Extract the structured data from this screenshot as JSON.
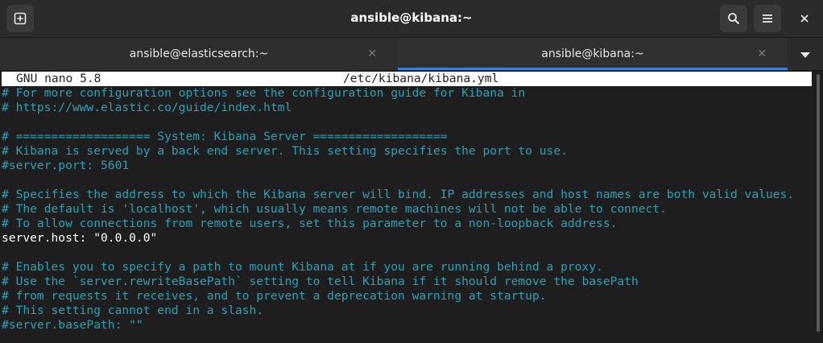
{
  "window": {
    "title": "ansible@kibana:~"
  },
  "icons": {
    "new_tab": "new-tab-icon",
    "search": "search-icon",
    "menu": "hamburger-menu-icon",
    "close": "close-icon",
    "tab_close": "tab-close-icon",
    "tab_dropdown": "chevron-down-icon"
  },
  "tabs": [
    {
      "label": "ansible@elasticsearch:~",
      "active": false
    },
    {
      "label": "ansible@kibana:~",
      "active": true
    }
  ],
  "nano": {
    "version": "GNU nano 5.8",
    "filename": "/etc/kibana/kibana.yml"
  },
  "lines": [
    {
      "text": "# For more configuration options see the configuration guide for Kibana in",
      "type": "comment"
    },
    {
      "text": "# https://www.elastic.co/guide/index.html",
      "type": "comment"
    },
    {
      "text": "",
      "type": "blank"
    },
    {
      "text": "# =================== System: Kibana Server ===================",
      "type": "comment"
    },
    {
      "text": "# Kibana is served by a back end server. This setting specifies the port to use.",
      "type": "comment"
    },
    {
      "text": "#server.port: 5601",
      "type": "comment"
    },
    {
      "text": "",
      "type": "blank"
    },
    {
      "text": "# Specifies the address to which the Kibana server will bind. IP addresses and host names are both valid values.",
      "type": "comment"
    },
    {
      "text": "# The default is 'localhost', which usually means remote machines will not be able to connect.",
      "type": "comment"
    },
    {
      "text": "# To allow connections from remote users, set this parameter to a non-loopback address.",
      "type": "comment"
    },
    {
      "text": "server.host: \"0.0.0.0\"",
      "type": "plain"
    },
    {
      "text": "",
      "type": "blank"
    },
    {
      "text": "# Enables you to specify a path to mount Kibana at if you are running behind a proxy.",
      "type": "comment"
    },
    {
      "text": "# Use the `server.rewriteBasePath` setting to tell Kibana if it should remove the basePath",
      "type": "comment"
    },
    {
      "text": "# from requests it receives, and to prevent a deprecation warning at startup.",
      "type": "comment"
    },
    {
      "text": "# This setting cannot end in a slash.",
      "type": "comment"
    },
    {
      "text": "#server.basePath: \"\"",
      "type": "comment"
    }
  ],
  "colors": {
    "comment": "#2aa1b3",
    "text": "#ffffff",
    "accent": "#3584e4",
    "background": "#1e1e1e"
  }
}
